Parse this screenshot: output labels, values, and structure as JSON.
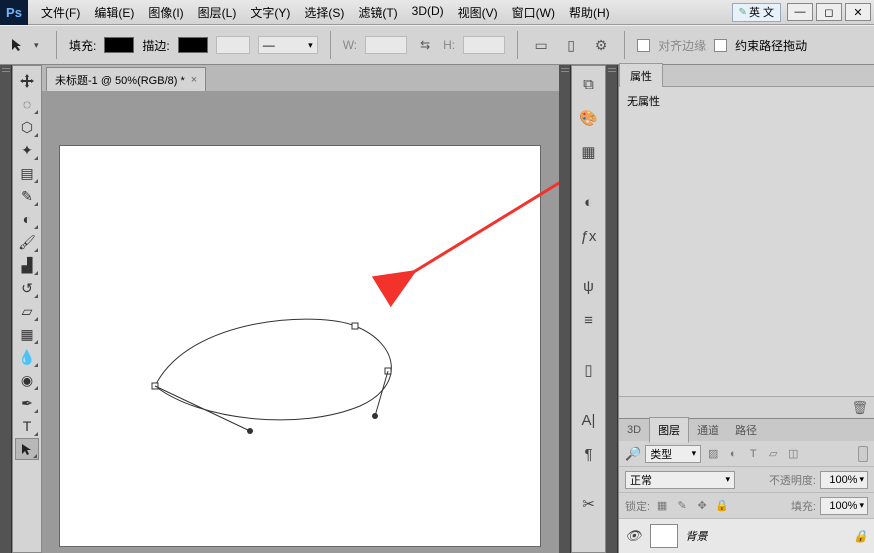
{
  "titlebar": {
    "app": "Ps",
    "lang_button": "英 文",
    "menus": [
      "文件(F)",
      "编辑(E)",
      "图像(I)",
      "图层(L)",
      "文字(Y)",
      "选择(S)",
      "滤镜(T)",
      "3D(D)",
      "视图(V)",
      "窗口(W)",
      "帮助(H)"
    ]
  },
  "options": {
    "fill_label": "填充:",
    "stroke_label": "描边:",
    "stroke_width": "",
    "stroke_style": "—",
    "w_label": "W:",
    "h_label": "H:",
    "align_edges_label": "对齐边缘",
    "constrain_label": "约束路径拖动"
  },
  "doc": {
    "tab_title": "未标题-1 @ 50%(RGB/8) *"
  },
  "props_panel": {
    "tab": "属性",
    "content": "无属性"
  },
  "layers_panel": {
    "tabs": [
      "3D",
      "图层",
      "通道",
      "路径"
    ],
    "kind_label": "类型",
    "blend_mode": "正常",
    "opacity_label": "不透明度:",
    "opacity_value": "100%",
    "lock_label": "锁定:",
    "fill_label": "填充:",
    "fill_value": "100%",
    "layer_name": "背景"
  }
}
